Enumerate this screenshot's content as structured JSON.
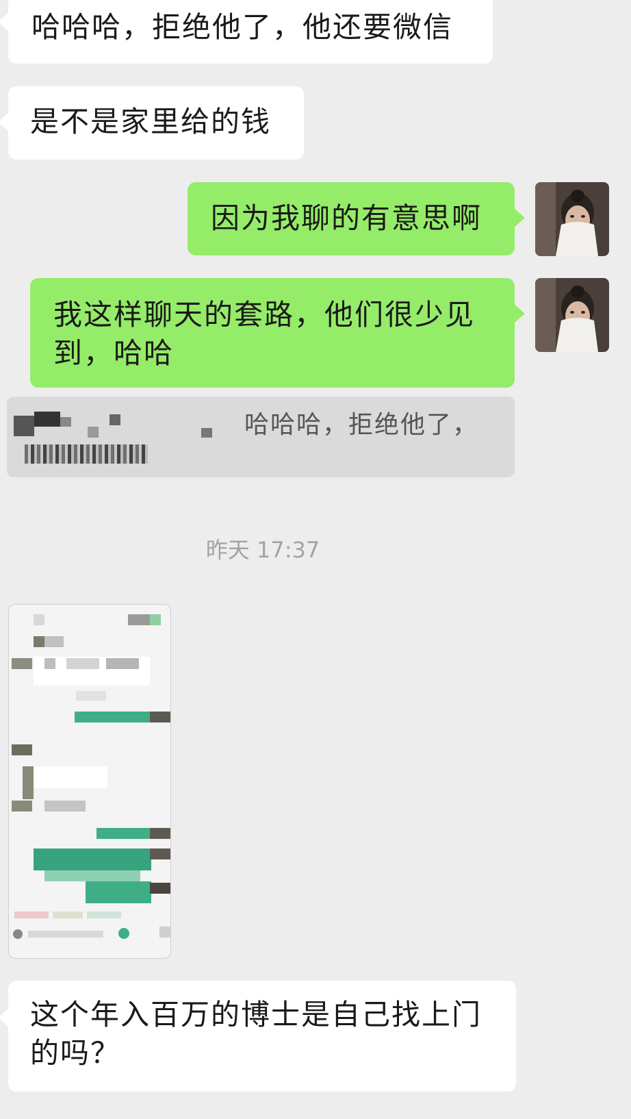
{
  "messages": [
    {
      "side": "left",
      "text": "哈哈哈，拒绝他了，他还要微信"
    },
    {
      "side": "left",
      "text": "是不是家里给的钱"
    },
    {
      "side": "right",
      "text": "因为我聊的有意思啊"
    },
    {
      "side": "right",
      "text": "我这样聊天的套路，他们很少见到，哈哈"
    },
    {
      "side": "left",
      "text": "这个年入百万的博士是自己找上门的吗？"
    }
  ],
  "quote": {
    "text": "哈哈哈，拒绝他了，"
  },
  "timestamp": "昨天 17:37",
  "colors": {
    "background": "#ededed",
    "sent_bubble": "#95ec69",
    "received_bubble": "#ffffff",
    "quote_bg": "#dadada",
    "timestamp_text": "#a3a3a3"
  },
  "icons": {
    "avatar": "user-avatar-photo",
    "shared_image": "blurred-chat-screenshot"
  }
}
